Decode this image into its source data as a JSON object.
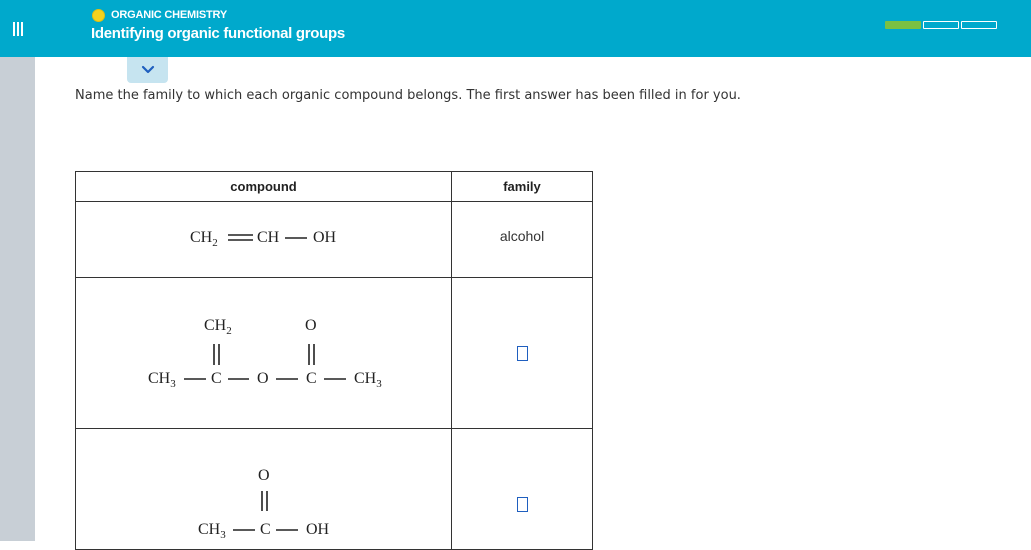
{
  "header": {
    "topic": "ORGANIC CHEMISTRY",
    "title": "Identifying organic functional groups",
    "progress": {
      "segments": 3,
      "filled": 1
    },
    "colors": {
      "bar": "#00a9cc",
      "topic_dot": "#f4d21f",
      "progress_fill": "#7bc043"
    }
  },
  "instructions": "Name the family to which each organic compound belongs. The first answer has been filled in for you.",
  "table": {
    "headers": {
      "compound": "compound",
      "family": "family"
    },
    "rows": [
      {
        "compound": {
          "ch2": "CH",
          "ch2_sub": "2",
          "ch": "CH",
          "oh": "OH"
        },
        "family": "alcohol"
      },
      {
        "compound": {
          "ch2_top": "CH",
          "ch2_top_sub": "2",
          "o_top": "O",
          "ch3_left": "CH",
          "ch3_left_sub": "3",
          "c1": "C",
          "o_mid": "O",
          "c2": "C",
          "ch3_right": "CH",
          "ch3_right_sub": "3"
        },
        "family": ""
      },
      {
        "compound": {
          "o_top": "O",
          "ch3": "CH",
          "ch3_sub": "3",
          "c": "C",
          "oh": "OH"
        },
        "family": ""
      }
    ]
  }
}
